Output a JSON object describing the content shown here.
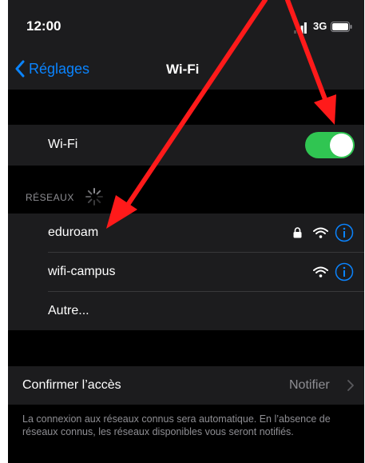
{
  "status_bar": {
    "time": "12:00",
    "network": "3G",
    "icons": [
      "signal-icon",
      "battery-icon"
    ]
  },
  "nav": {
    "back_label": "Réglages",
    "title": "Wi-Fi"
  },
  "wifi": {
    "label": "Wi-Fi",
    "enabled": true
  },
  "networks": {
    "header": "RÉSEAUX",
    "items": [
      {
        "name": "eduroam",
        "secured": true
      },
      {
        "name": "wifi-campus",
        "secured": false
      },
      {
        "name": "Autre..."
      }
    ]
  },
  "confirm_access": {
    "label": "Confirmer l’accès",
    "value": "Notifier"
  },
  "footer": "La connexion aux réseaux connus sera automatique. En l’absence de réseaux connus, les réseaux disponibles vous seront notifiés.",
  "colors": {
    "accent": "#0a84ff",
    "toggle_on": "#30c552",
    "annotation_arrow": "#ff1a1a"
  }
}
